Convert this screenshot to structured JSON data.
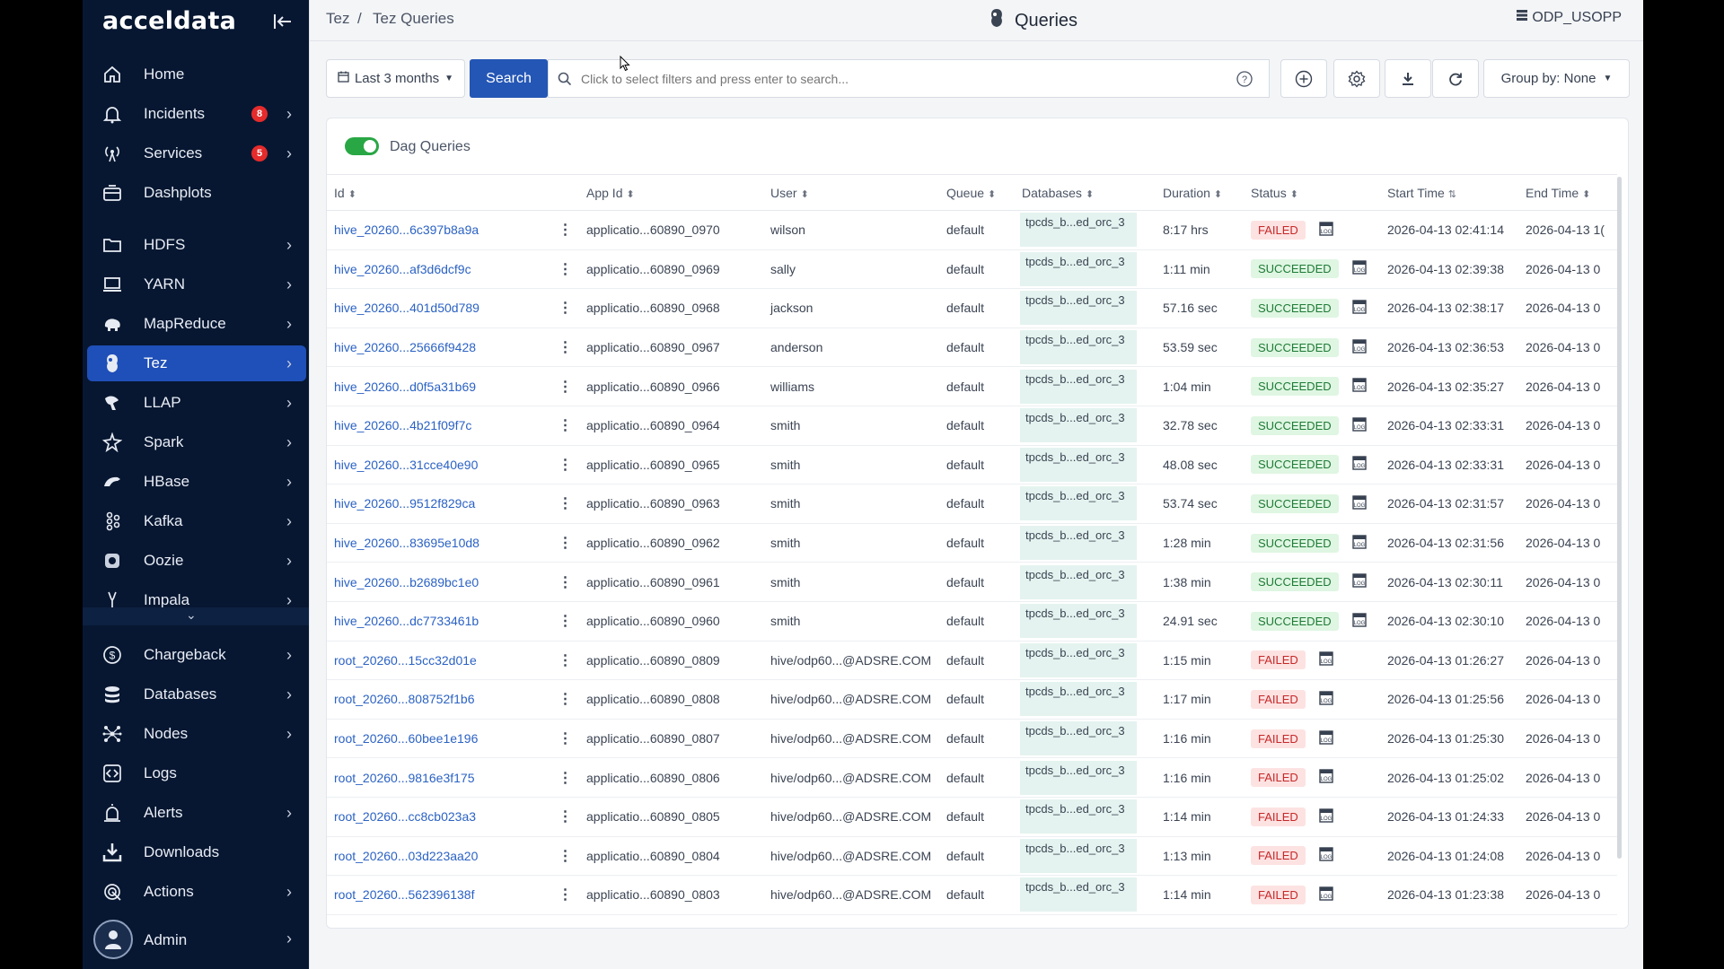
{
  "sidebar": {
    "logo": "acceldata",
    "items": [
      {
        "label": "Home",
        "icon": "home-icon",
        "chevron": false,
        "badge": null
      },
      {
        "label": "Incidents",
        "icon": "bell-icon",
        "chevron": true,
        "badge": "8"
      },
      {
        "label": "Services",
        "icon": "broadcast-icon",
        "chevron": true,
        "badge": "5"
      },
      {
        "label": "Dashplots",
        "icon": "dashboard-icon",
        "chevron": false,
        "badge": null
      },
      {
        "label": "HDFS",
        "icon": "folder-icon",
        "chevron": true,
        "badge": null
      },
      {
        "label": "YARN",
        "icon": "monitor-icon",
        "chevron": true,
        "badge": null
      },
      {
        "label": "MapReduce",
        "icon": "elephant-icon",
        "chevron": true,
        "badge": null
      },
      {
        "label": "Tez",
        "icon": "tez-icon",
        "chevron": true,
        "badge": null,
        "active": true
      },
      {
        "label": "LLAP",
        "icon": "llap-icon",
        "chevron": true,
        "badge": null
      },
      {
        "label": "Spark",
        "icon": "spark-icon",
        "chevron": true,
        "badge": null
      },
      {
        "label": "HBase",
        "icon": "hbase-icon",
        "chevron": true,
        "badge": null
      },
      {
        "label": "Kafka",
        "icon": "kafka-icon",
        "chevron": true,
        "badge": null
      },
      {
        "label": "Oozie",
        "icon": "oozie-icon",
        "chevron": true,
        "badge": null
      },
      {
        "label": "Impala",
        "icon": "impala-icon",
        "chevron": true,
        "badge": null
      },
      {
        "label": "Chargeback",
        "icon": "dollar-icon",
        "chevron": true,
        "badge": null
      },
      {
        "label": "Databases",
        "icon": "database-icon",
        "chevron": true,
        "badge": null
      },
      {
        "label": "Nodes",
        "icon": "nodes-icon",
        "chevron": true,
        "badge": null
      },
      {
        "label": "Logs",
        "icon": "code-icon",
        "chevron": false,
        "badge": null
      },
      {
        "label": "Alerts",
        "icon": "alert-icon",
        "chevron": true,
        "badge": null
      },
      {
        "label": "Downloads",
        "icon": "download-icon",
        "chevron": false,
        "badge": null
      },
      {
        "label": "Actions",
        "icon": "actions-icon",
        "chevron": true,
        "badge": null
      }
    ],
    "admin_label": "Admin"
  },
  "header": {
    "breadcrumb_root": "Tez",
    "breadcrumb_sep": "/",
    "breadcrumb_current": "Tez Queries",
    "title": "Queries",
    "cluster": "ODP_USOPP"
  },
  "toolbar": {
    "date_range": "Last 3 months",
    "search_label": "Search",
    "search_placeholder": "Click to select filters and press enter to search...",
    "group_by": "Group by: None"
  },
  "panel": {
    "toggle_label": "Dag Queries",
    "toggle_on": true
  },
  "table": {
    "columns": [
      "Id",
      "",
      "App Id",
      "User",
      "Queue",
      "Databases",
      "Duration",
      "Status",
      "Start Time",
      "End Time"
    ],
    "rows": [
      {
        "id": "hive_20260...6c397b8a9a",
        "app_id": "applicatio...60890_0970",
        "user": "wilson",
        "queue": "default",
        "db": "tpcds_b...ed_orc_3",
        "duration": "8:17 hrs",
        "status": "FAILED",
        "start": "2026-04-13 02:41:14",
        "end": "2026-04-13 1("
      },
      {
        "id": "hive_20260...af3d6dcf9c",
        "app_id": "applicatio...60890_0969",
        "user": "sally",
        "queue": "default",
        "db": "tpcds_b...ed_orc_3",
        "duration": "1:11 min",
        "status": "SUCCEEDED",
        "start": "2026-04-13 02:39:38",
        "end": "2026-04-13 0"
      },
      {
        "id": "hive_20260...401d50d789",
        "app_id": "applicatio...60890_0968",
        "user": "jackson",
        "queue": "default",
        "db": "tpcds_b...ed_orc_3",
        "duration": "57.16 sec",
        "status": "SUCCEEDED",
        "start": "2026-04-13 02:38:17",
        "end": "2026-04-13 0"
      },
      {
        "id": "hive_20260...25666f9428",
        "app_id": "applicatio...60890_0967",
        "user": "anderson",
        "queue": "default",
        "db": "tpcds_b...ed_orc_3",
        "duration": "53.59 sec",
        "status": "SUCCEEDED",
        "start": "2026-04-13 02:36:53",
        "end": "2026-04-13 0"
      },
      {
        "id": "hive_20260...d0f5a31b69",
        "app_id": "applicatio...60890_0966",
        "user": "williams",
        "queue": "default",
        "db": "tpcds_b...ed_orc_3",
        "duration": "1:04 min",
        "status": "SUCCEEDED",
        "start": "2026-04-13 02:35:27",
        "end": "2026-04-13 0"
      },
      {
        "id": "hive_20260...4b21f09f7c",
        "app_id": "applicatio...60890_0964",
        "user": "smith",
        "queue": "default",
        "db": "tpcds_b...ed_orc_3",
        "duration": "32.78 sec",
        "status": "SUCCEEDED",
        "start": "2026-04-13 02:33:31",
        "end": "2026-04-13 0"
      },
      {
        "id": "hive_20260...31cce40e90",
        "app_id": "applicatio...60890_0965",
        "user": "smith",
        "queue": "default",
        "db": "tpcds_b...ed_orc_3",
        "duration": "48.08 sec",
        "status": "SUCCEEDED",
        "start": "2026-04-13 02:33:31",
        "end": "2026-04-13 0"
      },
      {
        "id": "hive_20260...9512f829ca",
        "app_id": "applicatio...60890_0963",
        "user": "smith",
        "queue": "default",
        "db": "tpcds_b...ed_orc_3",
        "duration": "53.74 sec",
        "status": "SUCCEEDED",
        "start": "2026-04-13 02:31:57",
        "end": "2026-04-13 0"
      },
      {
        "id": "hive_20260...83695e10d8",
        "app_id": "applicatio...60890_0962",
        "user": "smith",
        "queue": "default",
        "db": "tpcds_b...ed_orc_3",
        "duration": "1:28 min",
        "status": "SUCCEEDED",
        "start": "2026-04-13 02:31:56",
        "end": "2026-04-13 0"
      },
      {
        "id": "hive_20260...b2689bc1e0",
        "app_id": "applicatio...60890_0961",
        "user": "smith",
        "queue": "default",
        "db": "tpcds_b...ed_orc_3",
        "duration": "1:38 min",
        "status": "SUCCEEDED",
        "start": "2026-04-13 02:30:11",
        "end": "2026-04-13 0"
      },
      {
        "id": "hive_20260...dc7733461b",
        "app_id": "applicatio...60890_0960",
        "user": "smith",
        "queue": "default",
        "db": "tpcds_b...ed_orc_3",
        "duration": "24.91 sec",
        "status": "SUCCEEDED",
        "start": "2026-04-13 02:30:10",
        "end": "2026-04-13 0"
      },
      {
        "id": "root_20260...15cc32d01e",
        "app_id": "applicatio...60890_0809",
        "user": "hive/odp60...@ADSRE.COM",
        "queue": "default",
        "db": "tpcds_b...ed_orc_3",
        "duration": "1:15 min",
        "status": "FAILED",
        "start": "2026-04-13 01:26:27",
        "end": "2026-04-13 0"
      },
      {
        "id": "root_20260...808752f1b6",
        "app_id": "applicatio...60890_0808",
        "user": "hive/odp60...@ADSRE.COM",
        "queue": "default",
        "db": "tpcds_b...ed_orc_3",
        "duration": "1:17 min",
        "status": "FAILED",
        "start": "2026-04-13 01:25:56",
        "end": "2026-04-13 0"
      },
      {
        "id": "root_20260...60bee1e196",
        "app_id": "applicatio...60890_0807",
        "user": "hive/odp60...@ADSRE.COM",
        "queue": "default",
        "db": "tpcds_b...ed_orc_3",
        "duration": "1:16 min",
        "status": "FAILED",
        "start": "2026-04-13 01:25:30",
        "end": "2026-04-13 0"
      },
      {
        "id": "root_20260...9816e3f175",
        "app_id": "applicatio...60890_0806",
        "user": "hive/odp60...@ADSRE.COM",
        "queue": "default",
        "db": "tpcds_b...ed_orc_3",
        "duration": "1:16 min",
        "status": "FAILED",
        "start": "2026-04-13 01:25:02",
        "end": "2026-04-13 0"
      },
      {
        "id": "root_20260...cc8cb023a3",
        "app_id": "applicatio...60890_0805",
        "user": "hive/odp60...@ADSRE.COM",
        "queue": "default",
        "db": "tpcds_b...ed_orc_3",
        "duration": "1:14 min",
        "status": "FAILED",
        "start": "2026-04-13 01:24:33",
        "end": "2026-04-13 0"
      },
      {
        "id": "root_20260...03d223aa20",
        "app_id": "applicatio...60890_0804",
        "user": "hive/odp60...@ADSRE.COM",
        "queue": "default",
        "db": "tpcds_b...ed_orc_3",
        "duration": "1:13 min",
        "status": "FAILED",
        "start": "2026-04-13 01:24:08",
        "end": "2026-04-13 0"
      },
      {
        "id": "root_20260...562396138f",
        "app_id": "applicatio...60890_0803",
        "user": "hive/odp60...@ADSRE.COM",
        "queue": "default",
        "db": "tpcds_b...ed_orc_3",
        "duration": "1:14 min",
        "status": "FAILED",
        "start": "2026-04-13 01:23:38",
        "end": "2026-04-13 0"
      }
    ]
  },
  "colors": {
    "sidebar_bg": "#071731",
    "active_nav": "#1f4fb8",
    "primary": "#2456b5",
    "link": "#2b62c4",
    "failed": "#c62828",
    "succeeded": "#1e7a36",
    "db_chip": "#e4f3ef",
    "toggle_on": "#29a745"
  }
}
